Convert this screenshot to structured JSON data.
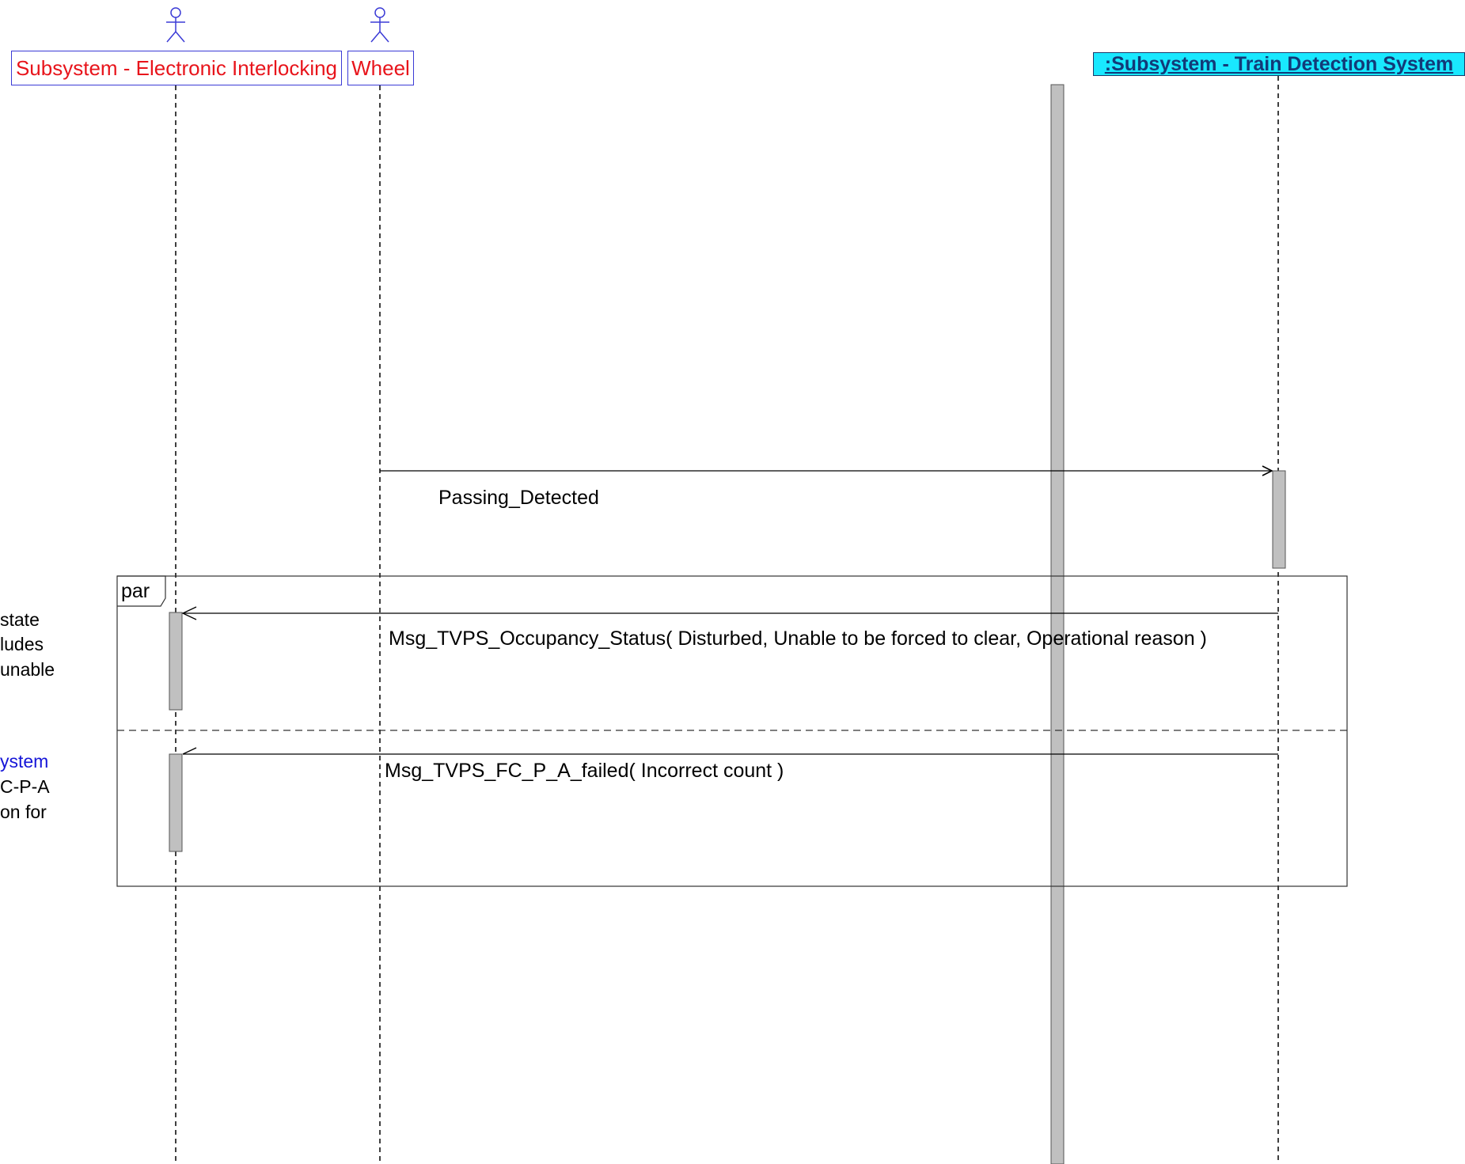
{
  "lifelines": {
    "interlocking": {
      "label": "Subsystem - Electronic Interlocking",
      "kind": "actor"
    },
    "wheel": {
      "label": "Wheel",
      "kind": "actor"
    },
    "train_detection": {
      "label": ":Subsystem - Train Detection System",
      "kind": "object"
    }
  },
  "messages": [
    {
      "label": "Passing_Detected",
      "from": "wheel",
      "to": "train_detection",
      "arrow": "synchronous"
    },
    {
      "label": "Msg_TVPS_Occupancy_Status( Disturbed, Unable to be forced to clear, Operational reason )",
      "from": "train_detection",
      "to": "interlocking",
      "arrow": "asynchronous"
    },
    {
      "label": "Msg_TVPS_FC_P_A_failed( Incorrect count )",
      "from": "train_detection",
      "to": "interlocking",
      "arrow": "asynchronous"
    }
  ],
  "combined_fragment": {
    "operator": "par",
    "operands": 2
  },
  "notes": {
    "note1_lines": [
      "state",
      "ludes",
      "unable"
    ],
    "note2_lines": [
      "ystem",
      "C-P-A",
      "on for"
    ]
  },
  "colors": {
    "actor_outline": "#3b3bd6",
    "actor_label": "#e8141b",
    "system_fill": "#19e8ff",
    "system_label": "#123a78",
    "activation_fill": "#c0c0c0",
    "note_highlight": "#1515d8"
  }
}
